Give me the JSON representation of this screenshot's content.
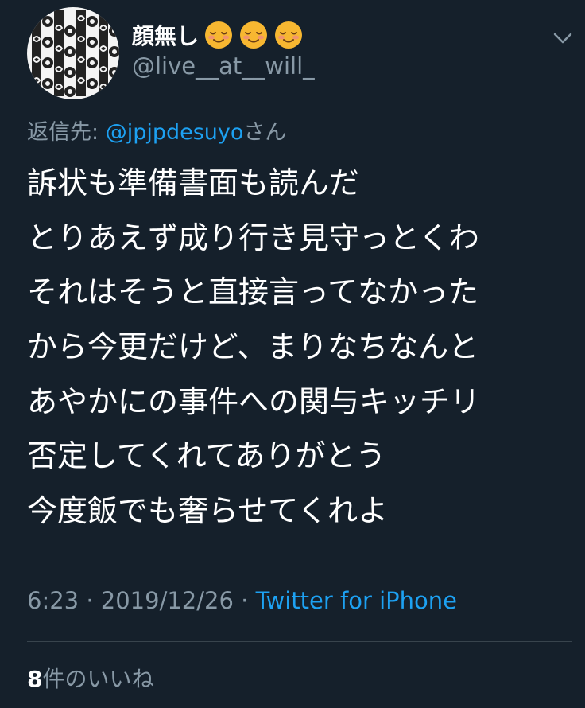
{
  "tweet": {
    "author": {
      "display_name": "顔無し",
      "display_emojis": [
        "smiling-face-icon",
        "smiling-face-icon",
        "smiling-face-icon"
      ],
      "handle": "@live__at__will_"
    },
    "reply_to": {
      "prefix": "返信先: ",
      "mention": "@jpjpdesuyo",
      "suffix": "さん"
    },
    "text_lines": [
      "訴状も準備書面も読んだ",
      "とりあえず成り行き見守っとくわ",
      "それはそうと直接言ってなかった",
      "から今更だけど、まりなちなんと",
      "あやかにの事件への関与キッチリ",
      "否定してくれてありがとう",
      "今度飯でも奢らせてくれよ"
    ],
    "meta": {
      "time": "6:23",
      "separator": " · ",
      "date": "2019/12/26",
      "source": "Twitter for iPhone"
    },
    "likes": {
      "count": "8",
      "label": "件のいいね"
    }
  },
  "colors": {
    "background": "#15202b",
    "text": "#ffffff",
    "secondary": "#8899a6",
    "link": "#1da1f2",
    "divider": "#38444d"
  }
}
